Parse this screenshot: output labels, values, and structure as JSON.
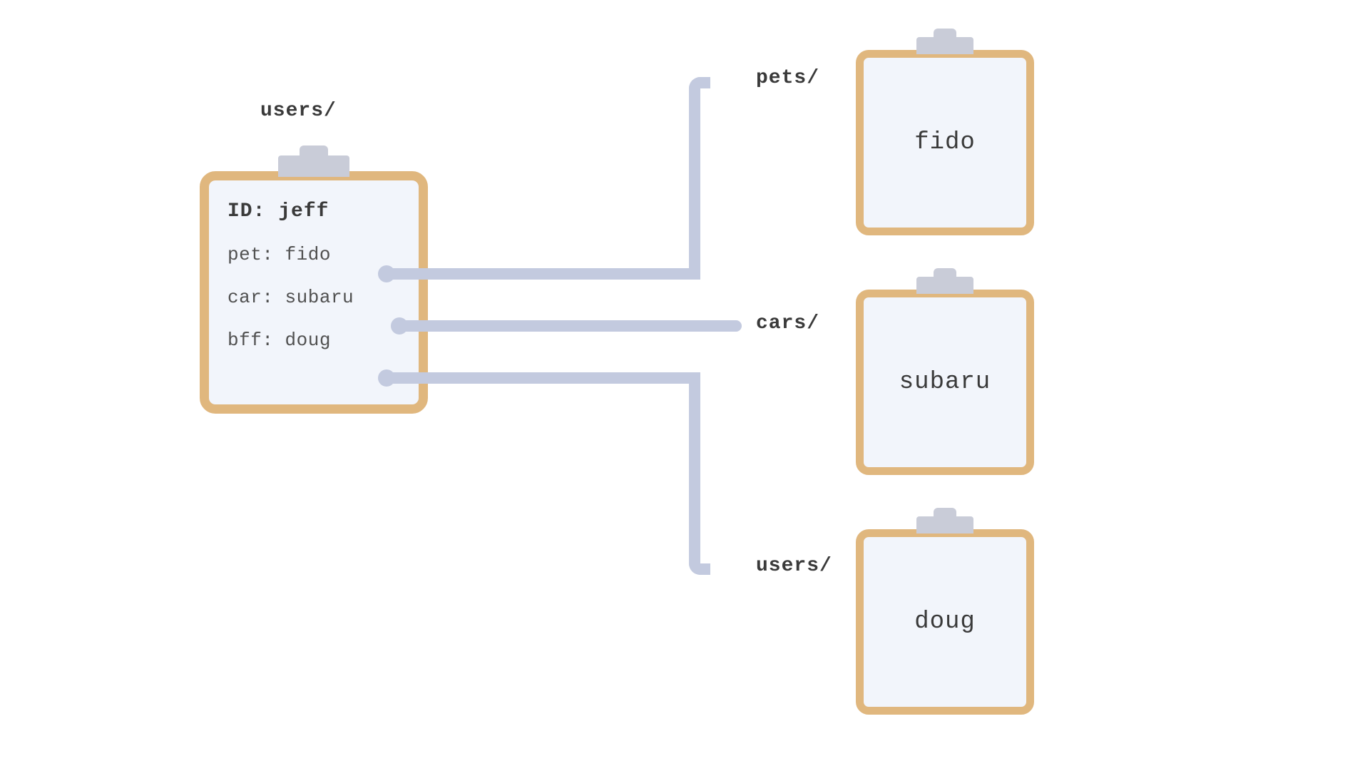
{
  "source": {
    "collection_label": "users/",
    "doc_id": "ID: jeff",
    "fields": [
      {
        "key": "pet",
        "value": "fido"
      },
      {
        "key": "car",
        "value": "subaru"
      },
      {
        "key": "bff",
        "value": "doug"
      }
    ]
  },
  "targets": [
    {
      "collection_label": "pets/",
      "doc_value": "fido"
    },
    {
      "collection_label": "cars/",
      "doc_value": "subaru"
    },
    {
      "collection_label": "users/",
      "doc_value": "doug"
    }
  ]
}
